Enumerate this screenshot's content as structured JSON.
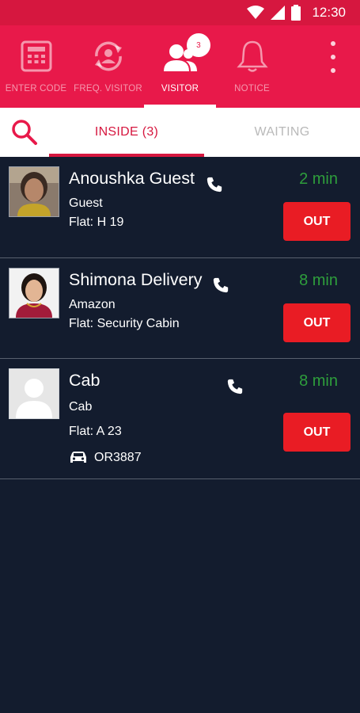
{
  "status_bar": {
    "time": "12:30"
  },
  "nav": {
    "items": [
      {
        "label": "ENTER CODE",
        "icon": "calculator-icon"
      },
      {
        "label": "FREQ. VISITOR",
        "icon": "refresh-person-icon"
      },
      {
        "label": "VISITOR",
        "icon": "visitors-icon",
        "badge": "3"
      },
      {
        "label": "NOTICE",
        "icon": "bell-icon"
      }
    ]
  },
  "tabs": {
    "inside": "INSIDE (3)",
    "waiting": "WAITING"
  },
  "visitors": [
    {
      "name": "Anoushka Guest",
      "type": "Guest",
      "flat": "Flat: H 19",
      "duration": "2 min",
      "action": "OUT"
    },
    {
      "name": "Shimona Delivery",
      "type": "Amazon",
      "flat": "Flat: Security Cabin",
      "duration": "8 min",
      "action": "OUT"
    },
    {
      "name": "Cab",
      "type": "Cab",
      "flat": "Flat: A 23",
      "vehicle": "OR3887",
      "duration": "8 min",
      "action": "OUT"
    }
  ],
  "colors": {
    "primary": "#e8194a",
    "status_bar": "#d6173f",
    "list_bg": "#131c2e",
    "duration": "#2e9e3c",
    "out_button": "#e91c24"
  }
}
